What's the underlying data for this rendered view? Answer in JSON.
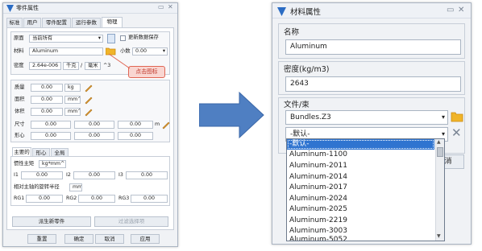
{
  "left": {
    "title": "零件属性",
    "tabs": [
      "标准",
      "用户",
      "零件配置",
      "运行参数",
      "物理"
    ],
    "origin_label": "原面",
    "origin_value": "当前所有",
    "update_checkbox_label": "更新数据保存",
    "material_label": "材料",
    "material_value": "Aluminum",
    "decimals_label": "小数",
    "decimals_value": "0.00",
    "density_label": "密度",
    "density_value": "2.64e-006",
    "density_unit1": "千克",
    "density_unit2": "毫米",
    "density_power": "^3",
    "props": [
      {
        "label": "质量",
        "value": "0.00",
        "unit": "kg"
      },
      {
        "label": "面积",
        "value": "0.00",
        "unit": "mm^2"
      },
      {
        "label": "体积",
        "value": "0.00",
        "unit": "mm^3"
      }
    ],
    "size_label": "尺寸",
    "size_values": [
      "0.00",
      "0.00",
      "0.00"
    ],
    "size_unit": "m",
    "centroid_label": "形心",
    "centroid_values": [
      "0.00",
      "0.00",
      "0.00"
    ],
    "subtabs": [
      "主要的",
      "形心",
      "全局"
    ],
    "inertia_label": "惯性主矩",
    "inertia_unit": "kg*mm^",
    "inertia_rows": [
      {
        "label": "I1",
        "value": "0.00"
      },
      {
        "label": "I2",
        "value": "0.00"
      },
      {
        "label": "I3",
        "value": "0.00"
      }
    ],
    "radius_label": "相对主轴的旋转半径",
    "radius_unit": "mm",
    "rg_rows": [
      {
        "label": "RG1",
        "value": "0.00"
      },
      {
        "label": "RG2",
        "value": "0.00"
      },
      {
        "label": "RG3",
        "value": "0.00"
      }
    ],
    "derive_button": "派生新零件",
    "filter_button": "过滤选择项",
    "bottom_buttons": [
      "重置",
      "确定",
      "取消",
      "应用"
    ],
    "callout_text": "点击图标"
  },
  "right": {
    "title": "材料属性",
    "name_label": "名称",
    "name_value": "Aluminum",
    "density_label": "密度(kg/m3)",
    "density_value": "2643",
    "file_label": "文件/束",
    "file_value": "Bundles.Z3",
    "default_value": "-默认-",
    "dropdown_items": [
      "-默认-",
      "Aluminum-1100",
      "Aluminum-2011",
      "Aluminum-2014",
      "Aluminum-2017",
      "Aluminum-2024",
      "Aluminum-2025",
      "Aluminum-2219",
      "Aluminum-3003",
      "Aluminum-5052"
    ],
    "hidden_button_partial": "消"
  },
  "colors": {
    "arrow": "#4f7fc2",
    "accent": "#2b6cc4",
    "callout_border": "#e06654",
    "selected_row": "#2f74d0"
  }
}
